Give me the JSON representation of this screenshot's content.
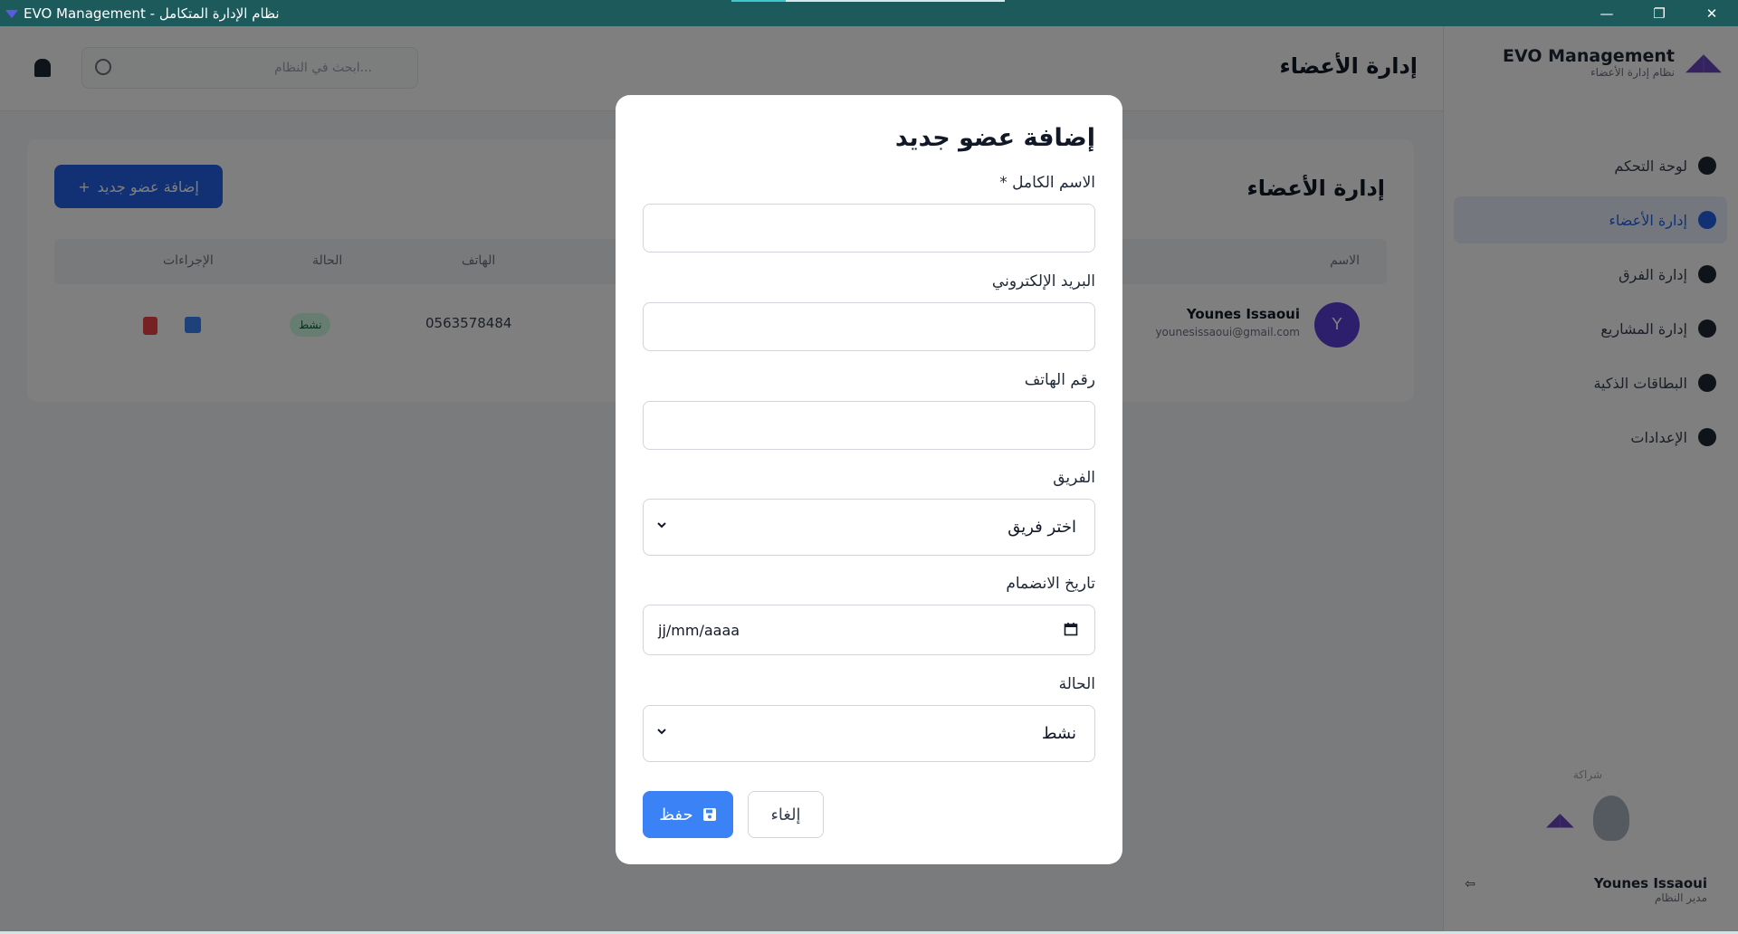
{
  "window": {
    "title": "EVO Management - نظام الإدارة المتكامل",
    "controls": {
      "minimize": "—",
      "restore": "❐",
      "close": "✕"
    },
    "loading_progress": 0.2
  },
  "sidebar": {
    "brand_name": "EVO Management",
    "brand_sub": "نظام إدارة الأعضاء",
    "items": [
      {
        "label": "لوحة التحكم"
      },
      {
        "label": "إدارة الأعضاء"
      },
      {
        "label": "إدارة الفرق"
      },
      {
        "label": "إدارة المشاريع"
      },
      {
        "label": "البطاقات الذكية"
      },
      {
        "label": "الإعدادات"
      }
    ],
    "footer_label": "شراكة",
    "user_name": "Younes Issaoui",
    "user_role": "مدير النظام",
    "logout": "خروج"
  },
  "topbar": {
    "page_heading": "إدارة الأعضاء",
    "search_placeholder": "ابحث في النظام..."
  },
  "content": {
    "section_title": "إدارة الأعضاء",
    "add_button": "إضافة عضو جديد",
    "columns": {
      "name": "الاسم",
      "phone": "الهاتف",
      "status": "الحالة",
      "actions": "الإجراءات"
    },
    "row": {
      "avatar": "Y",
      "name": "Younes Issaoui",
      "email": "younesissaoui@gmail.com",
      "phone": "0563578484",
      "status": "نشط"
    }
  },
  "modal": {
    "title": "إضافة عضو جديد",
    "full_name_label": "الاسم الكامل *",
    "email_label": "البريد الإلكتروني",
    "phone_label": "رقم الهاتف",
    "team_label": "الفريق",
    "team_value": "اختر فريق",
    "join_date_label": "تاريخ الانضمام",
    "join_date_value": "jj/mm/aaaa",
    "status_label": "الحالة",
    "status_value": "نشط",
    "save_button": "حفظ",
    "cancel_button": "إلغاء"
  },
  "colors": {
    "titlebar": "#1d5a5c",
    "primary": "#3b82f6",
    "overlay": "rgba(0,0,0,0.5)"
  }
}
